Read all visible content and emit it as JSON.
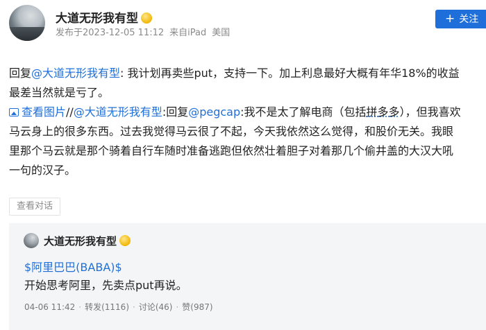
{
  "post": {
    "author": "大道无形我有型",
    "meta": {
      "published": "发布于2023-12-05 11:12",
      "source": "来自iPad",
      "location": "美国"
    },
    "follow_label": "关注",
    "line1_prefix": "回复",
    "line1_mention": "@大道无形我有型",
    "line1_text": ": 我计划再卖些put，支持一下。加上利息最好大概有年华18%的收益",
    "line2_text": "最差当然就是亏了。",
    "line3_link": "查看图片",
    "line3_sep": "//",
    "line3_mention": "@大道无形我有型",
    "line3_reply": ":回复",
    "line3_mention2": "@pegcap",
    "line3_text": ":我不是太了解电商（包括",
    "line3_keyword": "拼多多",
    "line3_text2": "），但我喜欢",
    "line4_text": "马云身上的很多东西。过去我觉得马云很了不起，今天我依然这么觉得，和股价无关。我眼",
    "line5_text": "里那个马云就是那个骑着自行车随时准备逃跑但依然壮着胆子对着那几个偷井盖的大汉大吼",
    "line6_text": "一句的汉子。",
    "view_conversation": "查看对话"
  },
  "repost": {
    "author": "大道无形我有型",
    "stock": "$阿里巴巴(BABA)$",
    "text": "开始思考阿里，先卖点put再说。",
    "time": "04-06 11:42",
    "reposts": "转发(1116)",
    "comments": "讨论(46)",
    "likes": "赞(987)"
  },
  "colors": {
    "link": "#1e6fd9",
    "button": "#1e6fd9",
    "repost_bg": "#f4f5f7"
  }
}
